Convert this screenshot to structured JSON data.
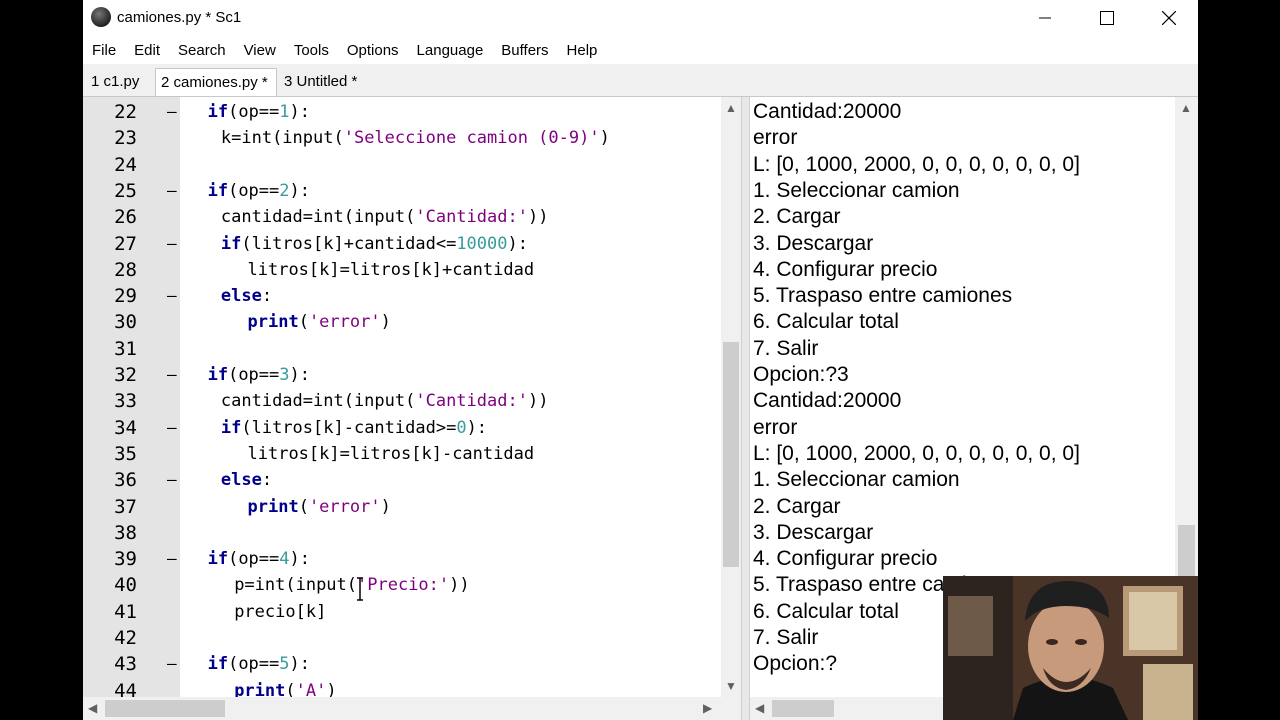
{
  "window": {
    "title": "camiones.py * Sc1",
    "controls": {
      "minimize": "—",
      "maximize": "☐",
      "close": "✕"
    }
  },
  "menu": [
    "File",
    "Edit",
    "Search",
    "View",
    "Tools",
    "Options",
    "Language",
    "Buffers",
    "Help"
  ],
  "tabs": [
    {
      "label": "1 c1.py",
      "active": false
    },
    {
      "label": "2 camiones.py *",
      "active": true
    },
    {
      "label": "3 Untitled *",
      "active": false
    }
  ],
  "editor": {
    "lines": [
      {
        "num": "22",
        "fold": "–",
        "indent": 2,
        "tokens": [
          [
            "kw",
            "if"
          ],
          [
            "",
            "("
          ],
          [
            "",
            "op=="
          ],
          [
            "num",
            "1"
          ],
          [
            "",
            ")"
          ],
          [
            "",
            ":"
          ]
        ]
      },
      {
        "num": "23",
        "fold": "",
        "indent": 3,
        "tokens": [
          [
            "",
            "k=int(input("
          ],
          [
            "str",
            "'Seleccione camion (0-9)'"
          ],
          [
            "",
            ")"
          ]
        ]
      },
      {
        "num": "24",
        "fold": "",
        "indent": 0,
        "tokens": []
      },
      {
        "num": "25",
        "fold": "–",
        "indent": 2,
        "tokens": [
          [
            "kw",
            "if"
          ],
          [
            "",
            "(op=="
          ],
          [
            "num",
            "2"
          ],
          [
            "",
            "):"
          ]
        ]
      },
      {
        "num": "26",
        "fold": "",
        "indent": 3,
        "tokens": [
          [
            "",
            "cantidad=int(input("
          ],
          [
            "str",
            "'Cantidad:'"
          ],
          [
            "",
            "))"
          ]
        ]
      },
      {
        "num": "27",
        "fold": "–",
        "indent": 3,
        "tokens": [
          [
            "kw",
            "if"
          ],
          [
            "",
            "(litros[k]+cantidad<="
          ],
          [
            "num",
            "10000"
          ],
          [
            "",
            "):"
          ]
        ]
      },
      {
        "num": "28",
        "fold": "",
        "indent": 5,
        "tokens": [
          [
            "",
            "litros[k]=litros[k]+cantidad"
          ]
        ]
      },
      {
        "num": "29",
        "fold": "–",
        "indent": 3,
        "tokens": [
          [
            "kw",
            "else"
          ],
          [
            "",
            ":"
          ]
        ]
      },
      {
        "num": "30",
        "fold": "",
        "indent": 5,
        "tokens": [
          [
            "kw",
            "print"
          ],
          [
            "",
            "("
          ],
          [
            "str",
            "'error'"
          ],
          [
            "",
            ")"
          ]
        ]
      },
      {
        "num": "31",
        "fold": "",
        "indent": 0,
        "tokens": []
      },
      {
        "num": "32",
        "fold": "–",
        "indent": 2,
        "tokens": [
          [
            "kw",
            "if"
          ],
          [
            "",
            "(op=="
          ],
          [
            "num",
            "3"
          ],
          [
            "",
            "):"
          ]
        ]
      },
      {
        "num": "33",
        "fold": "",
        "indent": 3,
        "tokens": [
          [
            "",
            "cantidad=int(input("
          ],
          [
            "str",
            "'Cantidad:'"
          ],
          [
            "",
            "))"
          ]
        ]
      },
      {
        "num": "34",
        "fold": "–",
        "indent": 3,
        "tokens": [
          [
            "kw",
            "if"
          ],
          [
            "",
            "(litros[k]-cantidad>="
          ],
          [
            "num",
            "0"
          ],
          [
            "",
            "):"
          ]
        ]
      },
      {
        "num": "35",
        "fold": "",
        "indent": 5,
        "tokens": [
          [
            "",
            "litros[k]=litros[k]-cantidad"
          ]
        ]
      },
      {
        "num": "36",
        "fold": "–",
        "indent": 3,
        "tokens": [
          [
            "kw",
            "else"
          ],
          [
            "",
            ":"
          ]
        ]
      },
      {
        "num": "37",
        "fold": "",
        "indent": 5,
        "tokens": [
          [
            "kw",
            "print"
          ],
          [
            "",
            "("
          ],
          [
            "str",
            "'error'"
          ],
          [
            "",
            ")"
          ]
        ]
      },
      {
        "num": "38",
        "fold": "",
        "indent": 0,
        "tokens": []
      },
      {
        "num": "39",
        "fold": "–",
        "indent": 2,
        "tokens": [
          [
            "kw",
            "if"
          ],
          [
            "",
            "(op=="
          ],
          [
            "num",
            "4"
          ],
          [
            "",
            "):"
          ]
        ]
      },
      {
        "num": "40",
        "fold": "",
        "indent": 4,
        "tokens": [
          [
            "",
            "p=int(input("
          ],
          [
            "str",
            "'Precio:'"
          ],
          [
            "",
            "))"
          ]
        ]
      },
      {
        "num": "41",
        "fold": "",
        "indent": 4,
        "tokens": [
          [
            "",
            "precio[k]"
          ]
        ]
      },
      {
        "num": "42",
        "fold": "",
        "indent": 0,
        "tokens": []
      },
      {
        "num": "43",
        "fold": "–",
        "indent": 2,
        "tokens": [
          [
            "kw",
            "if"
          ],
          [
            "",
            "(op=="
          ],
          [
            "num",
            "5"
          ],
          [
            "",
            "):"
          ]
        ]
      },
      {
        "num": "44",
        "fold": "",
        "indent": 4,
        "tokens": [
          [
            "kw",
            "print"
          ],
          [
            "",
            "("
          ],
          [
            "str",
            "'A'"
          ],
          [
            "",
            ")"
          ]
        ]
      }
    ]
  },
  "output": {
    "lines": [
      "Cantidad:20000",
      "error",
      "L: [0, 1000, 2000, 0, 0, 0, 0, 0, 0, 0]",
      "1. Seleccionar camion",
      "2. Cargar",
      "3. Descargar",
      "4. Configurar precio",
      "5. Traspaso entre camiones",
      "6. Calcular total",
      "7. Salir",
      "Opcion:?3",
      "Cantidad:20000",
      "error",
      "L: [0, 1000, 2000, 0, 0, 0, 0, 0, 0, 0]",
      "1. Seleccionar camion",
      "2. Cargar",
      "3. Descargar",
      "4. Configurar precio",
      "5. Traspaso entre camiones",
      "6. Calcular total",
      "7. Salir",
      "Opcion:?"
    ]
  },
  "colors": {
    "keyword": "#00008b",
    "string": "#7f007f",
    "number": "#3a9b9b",
    "gutter": "#e4e4e4"
  }
}
